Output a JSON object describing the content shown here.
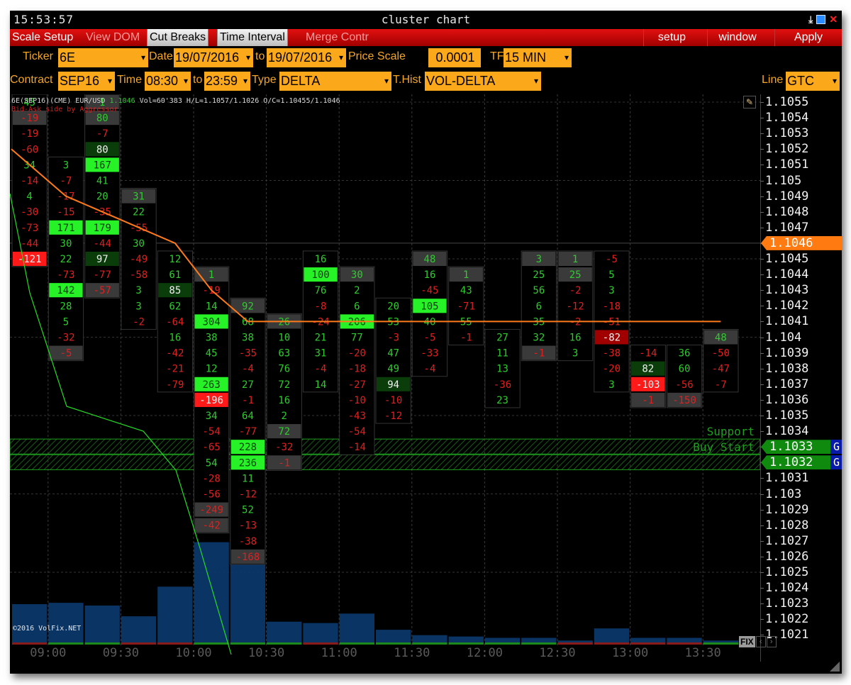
{
  "window": {
    "clock": "15:53:57",
    "title": "cluster chart",
    "icons": [
      "minimize-icon",
      "restore-icon",
      "close-icon"
    ]
  },
  "menubar": {
    "items": [
      {
        "label": "Scale Setup",
        "style": "red"
      },
      {
        "label": "View DOM",
        "style": "dim"
      },
      {
        "label": "Cut Breaks",
        "style": "grey"
      },
      {
        "label": "Time Interval",
        "style": "grey"
      },
      {
        "label": "Merge Contr",
        "style": "dim"
      }
    ],
    "right_items": [
      "setup",
      "window",
      "Apply"
    ]
  },
  "controls_row1": {
    "ticker_label": "Ticker",
    "ticker_value": "6E",
    "date_label": "Date",
    "date_from": "19/07/2016",
    "to_label": "to",
    "date_to": "19/07/2016",
    "price_scale_label": "Price Scale",
    "price_scale_value": "0.0001",
    "tf_label": "TF",
    "tf_value": "15 MIN"
  },
  "controls_row2": {
    "contract_label": "Contract",
    "contract_value": "SEP16",
    "time_label": "Time",
    "time_from": "08:30",
    "to_label": "to",
    "time_to": "23:59",
    "type_label": "Type",
    "type_value": "DELTA",
    "thist_label": "T.Hist",
    "thist_value": "VOL-DELTA",
    "line_label": "Line",
    "line_value": "GTC"
  },
  "chart_header": {
    "instrument": "6E(SEP16)(CME) EUR/USD",
    "last": "1.1046",
    "stats": "Vol=60'383  H/L=1.1057/1.1026  O/C=1.10455/1.1046",
    "note": "Bid-Ask side by Aggressor",
    "copyright": "©2016 VolFix.NET"
  },
  "levels": [
    {
      "label": "Support",
      "price": "1.1034"
    },
    {
      "label": "Buy Start",
      "price": "1.1033",
      "badge": "G"
    },
    {
      "label": "",
      "price": "1.1032",
      "badge": "G"
    }
  ],
  "current_price": "1.1046",
  "fix_button": "FIX",
  "chart_data": {
    "type": "table",
    "title": "cluster chart — 6E SEP16 DELTA, 15 MIN",
    "price_axis": [
      "1.1055",
      "1.1054",
      "1.1053",
      "1.1052",
      "1.1051",
      "1.105",
      "1.1049",
      "1.1048",
      "1.1047",
      "1.1046",
      "1.1045",
      "1.1044",
      "1.1043",
      "1.1042",
      "1.1041",
      "1.104",
      "1.1039",
      "1.1038",
      "1.1037",
      "1.1036",
      "1.1035",
      "1.1034",
      "1.1033",
      "1.1032",
      "1.1031",
      "1.103",
      "1.1029",
      "1.1028",
      "1.1027",
      "1.1026",
      "1.1025",
      "1.1024",
      "1.1023",
      "1.1022",
      "1.1021"
    ],
    "price_range": [
      1.1021,
      1.1055
    ],
    "price_step": 0.0001,
    "time_ticks": [
      "09:00",
      "09:30",
      "10:00",
      "10:30",
      "11:00",
      "11:30",
      "12:00",
      "12:30",
      "13:00",
      "13:30"
    ],
    "columns": [
      {
        "time": "08:45",
        "top": 1.1055,
        "values": [
          45,
          -19,
          -19,
          -60,
          34,
          -14,
          4,
          -30,
          -73,
          -44,
          -121
        ],
        "hi": {
          "10": "red"
        },
        "grey": [
          1
        ]
      },
      {
        "time": "09:00",
        "top": 1.1051,
        "values": [
          3,
          -7,
          -17,
          -15,
          171,
          30,
          22,
          -73,
          142,
          28,
          5,
          -32,
          -5
        ],
        "hi": {
          "4": "lime",
          "8": "lime"
        },
        "grey": [
          12
        ]
      },
      {
        "time": "09:15",
        "top": 1.1055,
        "values": [
          1,
          80,
          -7,
          80,
          167,
          41,
          20,
          -35,
          179,
          -44,
          97,
          -77,
          -57
        ],
        "hi": {
          "3": "dark",
          "4": "lime",
          "8": "lime",
          "10": "dark"
        },
        "grey": [
          0,
          1,
          12
        ]
      },
      {
        "time": "09:30",
        "top": 1.1049,
        "values": [
          31,
          22,
          -55,
          30,
          -49,
          -58,
          3,
          3,
          -2
        ],
        "hi": {},
        "grey": [
          0
        ]
      },
      {
        "time": "09:45",
        "top": 1.1045,
        "values": [
          12,
          61,
          85,
          62,
          -64,
          16,
          -42,
          -21,
          -79
        ],
        "hi": {
          "2": "dark"
        },
        "grey": []
      },
      {
        "time": "10:00",
        "top": 1.1044,
        "values": [
          1,
          -19,
          14,
          304,
          38,
          45,
          12,
          263,
          -196,
          34,
          -54,
          -65,
          54,
          -28,
          -56,
          -249,
          -42
        ],
        "hi": {
          "3": "lime",
          "7": "lime",
          "8": "red"
        },
        "grey": [
          0,
          15,
          16
        ]
      },
      {
        "time": "10:15",
        "top": 1.1042,
        "values": [
          92,
          68,
          38,
          -35,
          -4,
          27,
          -1,
          64,
          -77,
          228,
          236,
          11,
          -12,
          52,
          -13,
          -38,
          -168
        ],
        "hi": {
          "9": "lime",
          "10": "lime"
        },
        "grey": [
          0,
          16
        ]
      },
      {
        "time": "10:30",
        "top": 1.1041,
        "values": [
          26,
          10,
          63,
          76,
          72,
          16,
          2,
          72,
          -32,
          -1
        ],
        "hi": {},
        "grey": [
          0,
          7,
          9
        ]
      },
      {
        "time": "10:45",
        "top": 1.1045,
        "values": [
          16,
          100,
          76,
          -8,
          -24,
          21,
          31,
          -4,
          14
        ],
        "hi": {
          "1": "lime"
        },
        "grey": []
      },
      {
        "time": "11:00",
        "top": 1.1044,
        "values": [
          30,
          2,
          6,
          206,
          77,
          -20,
          -18,
          -27,
          -10,
          -43,
          -54,
          -14
        ],
        "hi": {
          "3": "lime"
        },
        "grey": [
          0
        ]
      },
      {
        "time": "11:15",
        "top": 1.1042,
        "values": [
          20,
          53,
          -3,
          47,
          49,
          94,
          -10,
          -12
        ],
        "hi": {
          "5": "dark"
        },
        "grey": []
      },
      {
        "time": "11:30",
        "top": 1.1045,
        "values": [
          48,
          16,
          -45,
          105,
          40,
          -5,
          -33,
          -4
        ],
        "hi": {
          "3": "lime"
        },
        "grey": [
          0
        ]
      },
      {
        "time": "11:45",
        "top": 1.1044,
        "values": [
          1,
          43,
          -71,
          55,
          -1
        ],
        "hi": {},
        "grey": [
          0
        ]
      },
      {
        "time": "12:00",
        "top": 1.104,
        "values": [
          27,
          11,
          13,
          -36,
          23
        ],
        "hi": {},
        "grey": []
      },
      {
        "time": "12:15",
        "top": 1.1045,
        "values": [
          3,
          25,
          56,
          6,
          35,
          32,
          -1
        ],
        "hi": {},
        "grey": [
          0,
          6
        ]
      },
      {
        "time": "12:30",
        "top": 1.1045,
        "values": [
          1,
          25,
          -2,
          -12,
          -2,
          16,
          3
        ],
        "hi": {},
        "grey": [
          0,
          1
        ]
      },
      {
        "time": "12:45",
        "top": 1.1045,
        "values": [
          -5,
          5,
          3,
          -18,
          -51,
          -82,
          -38,
          -20,
          3
        ],
        "hi": {
          "5": "darkred"
        },
        "grey": []
      },
      {
        "time": "13:00",
        "top": 1.1039,
        "values": [
          -14,
          82,
          -103,
          -1
        ],
        "hi": {
          "1": "dark",
          "2": "red"
        },
        "grey": [
          3
        ]
      },
      {
        "time": "13:15",
        "top": 1.1039,
        "values": [
          36,
          60,
          -56,
          -150
        ],
        "hi": {},
        "grey": [
          3
        ]
      },
      {
        "time": "13:30",
        "top": 1.104,
        "values": [
          48,
          -50,
          -47,
          -7
        ],
        "hi": {},
        "grey": [
          0
        ]
      }
    ],
    "poc_line": [
      1.1052,
      1.1049,
      1.1048,
      1.1047,
      1.1046,
      1.1043,
      1.1041,
      1.1041,
      1.1041,
      1.1041,
      1.1041,
      1.1041,
      1.1041,
      1.1041,
      1.1041,
      1.1041,
      1.1041,
      1.1041,
      1.1041,
      1.1041
    ],
    "cum_delta_line": [
      1.105,
      1.1037,
      1.1036,
      1.1035,
      1.1031,
      1.1019,
      1.1012
    ],
    "volume_hist": [
      30,
      31,
      29,
      21,
      43,
      76,
      96,
      17,
      16,
      23,
      11,
      7,
      6,
      5,
      5,
      3,
      12,
      5,
      5,
      3
    ],
    "volume_delta": [
      -1,
      1,
      2,
      -1,
      -1,
      1,
      3,
      1,
      -1,
      1,
      1,
      1,
      1,
      2,
      1,
      -1,
      -1,
      -1,
      -1,
      1
    ]
  }
}
